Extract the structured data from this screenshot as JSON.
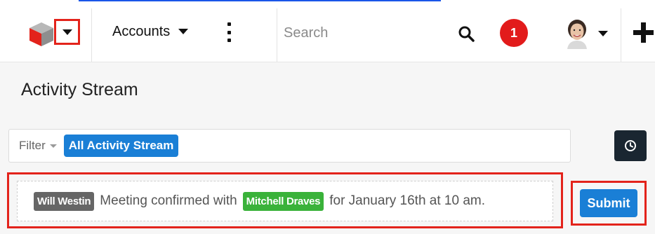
{
  "navbar": {
    "module_tab_label": "Accounts",
    "search_placeholder": "Search",
    "notification_count": "1",
    "icons": {
      "logo": "sugar-cube-logo-icon",
      "logo_menu": "chevron-down-icon",
      "more": "vertical-dots-icon",
      "search": "search-icon",
      "profile": "avatar",
      "create": "plus-icon"
    }
  },
  "page": {
    "title": "Activity Stream"
  },
  "filter": {
    "label": "Filter",
    "selected": "All Activity Stream",
    "toggle_icon": "clock-icon"
  },
  "activity": {
    "user_tag": "Will Westin",
    "text_before": "Meeting confirmed with",
    "contact_tag": "Mitchell Draves",
    "text_after": "for January 16th at 10 am."
  },
  "submit": {
    "label": "Submit"
  },
  "colors": {
    "accent_blue": "#1a7fd6",
    "highlight_red": "#e3231b",
    "notification_red": "#e21b1b",
    "contact_green": "#3ab23a",
    "user_gray": "#666666",
    "dark_button": "#1a2631"
  }
}
